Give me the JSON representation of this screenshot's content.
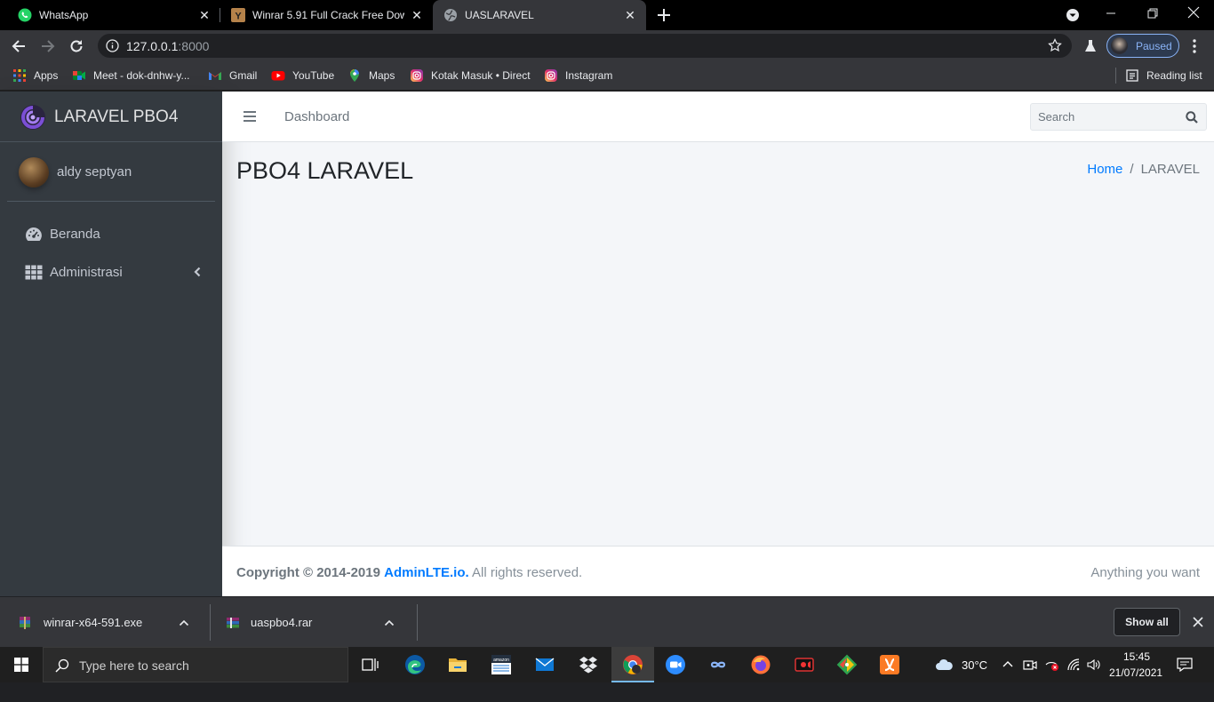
{
  "browser": {
    "tabs": [
      {
        "title": "WhatsApp",
        "favicon": "whatsapp-icon"
      },
      {
        "title": "Winrar 5.91 Full Crack Free Down",
        "favicon": "y-icon"
      },
      {
        "title": "UASLARAVEL",
        "favicon": "globe-icon",
        "active": true
      }
    ],
    "url_host": "127.0.0.1",
    "url_port": ":8000",
    "profile_label": "Paused",
    "bookmarks": [
      {
        "label": "Apps",
        "icon": "apps-grid-icon"
      },
      {
        "label": "Meet - dok-dnhw-y...",
        "icon": "meet-icon"
      },
      {
        "label": "Gmail",
        "icon": "gmail-icon"
      },
      {
        "label": "YouTube",
        "icon": "youtube-icon"
      },
      {
        "label": "Maps",
        "icon": "maps-icon"
      },
      {
        "label": "Kotak Masuk • Direct",
        "icon": "instagram-icon"
      },
      {
        "label": "Instagram",
        "icon": "instagram-icon"
      }
    ],
    "reading_list": "Reading list"
  },
  "app": {
    "brand": "LARAVEL PBO4",
    "user": "aldy septyan",
    "nav": [
      {
        "label": "Beranda",
        "icon": "tachometer-icon"
      },
      {
        "label": "Administrasi",
        "icon": "th-grid-icon"
      }
    ],
    "topnav": {
      "link": "Dashboard",
      "search_placeholder": "Search"
    },
    "page_title": "PBO4 LARAVEL",
    "breadcrumb": {
      "home": "Home",
      "separator": "/",
      "current": "LARAVEL"
    },
    "footer": {
      "copyright": "Copyright © 2014-2019",
      "link": "AdminLTE.io.",
      "rights": "All rights reserved.",
      "right": "Anything you want"
    }
  },
  "downloads": {
    "items": [
      {
        "name": "winrar-x64-591.exe"
      },
      {
        "name": "uaspbo4.rar"
      }
    ],
    "show_all": "Show all"
  },
  "taskbar": {
    "search_placeholder": "Type here to search",
    "temperature": "30°C",
    "time": "15:45",
    "date": "21/07/2021"
  },
  "colors": {
    "sidebar_bg": "#343a40",
    "content_bg": "#f4f6f9",
    "link": "#007bff",
    "chrome_bg": "#35363a"
  }
}
